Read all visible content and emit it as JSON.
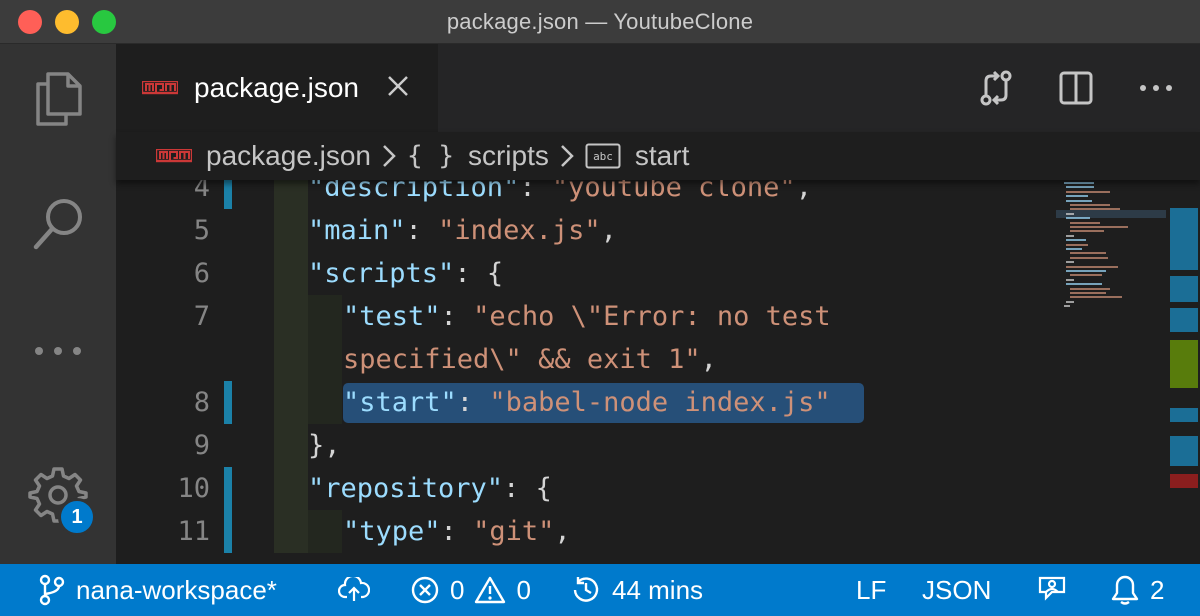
{
  "window": {
    "title": "package.json — YoutubeClone"
  },
  "activity_bar": {
    "items": [
      "files-icon",
      "search-icon",
      "more-icon",
      "gear-icon"
    ],
    "settings_badge": "1"
  },
  "tabs": [
    {
      "label": "package.json",
      "icon": "npm-icon",
      "active": true
    }
  ],
  "tab_actions": [
    "compare-changes-icon",
    "split-editor-icon",
    "more-actions-icon"
  ],
  "breadcrumb": {
    "file": "package.json",
    "object_icon": "{ }",
    "object": "scripts",
    "string_icon": "abc",
    "string": "start"
  },
  "editor": {
    "lines": [
      {
        "num": "4",
        "indent": 1,
        "parts": [
          [
            "k",
            "\"description\""
          ],
          [
            "p",
            ": "
          ],
          [
            "s",
            "\"youtube clone\""
          ],
          [
            "p",
            ","
          ]
        ]
      },
      {
        "num": "5",
        "indent": 1,
        "parts": [
          [
            "k",
            "\"main\""
          ],
          [
            "p",
            ": "
          ],
          [
            "s",
            "\"index.js\""
          ],
          [
            "p",
            ","
          ]
        ]
      },
      {
        "num": "6",
        "indent": 1,
        "parts": [
          [
            "k",
            "\"scripts\""
          ],
          [
            "p",
            ": {"
          ]
        ]
      },
      {
        "num": "7",
        "indent": 2,
        "parts": [
          [
            "k",
            "\"test\""
          ],
          [
            "p",
            ": "
          ],
          [
            "s",
            "\"echo \\\"Error: no test"
          ]
        ]
      },
      {
        "num": "",
        "indent": 2,
        "parts": [
          [
            "s",
            "specified\\\" && exit 1\""
          ],
          [
            "p",
            ","
          ]
        ]
      },
      {
        "num": "8",
        "indent": 2,
        "parts": [
          [
            "k",
            "\"start\""
          ],
          [
            "p",
            ": "
          ],
          [
            "s",
            "\"babel-node index.js\""
          ]
        ]
      },
      {
        "num": "9",
        "indent": 1,
        "parts": [
          [
            "p",
            "},"
          ]
        ]
      },
      {
        "num": "10",
        "indent": 1,
        "parts": [
          [
            "k",
            "\"repository\""
          ],
          [
            "p",
            ": {"
          ]
        ]
      },
      {
        "num": "11",
        "indent": 2,
        "parts": [
          [
            "k",
            "\"type\""
          ],
          [
            "p",
            ": "
          ],
          [
            "s",
            "\"git\""
          ],
          [
            "p",
            ","
          ]
        ]
      }
    ],
    "selected_line": "8"
  },
  "statusbar": {
    "branch": "nana-workspace*",
    "errors": "0",
    "warnings": "0",
    "time": "44 mins",
    "eol": "LF",
    "language": "JSON",
    "notifications": "2"
  },
  "colors": {
    "accent": "#007acc",
    "selection": "#264f78",
    "npm_red": "#cb3837"
  }
}
